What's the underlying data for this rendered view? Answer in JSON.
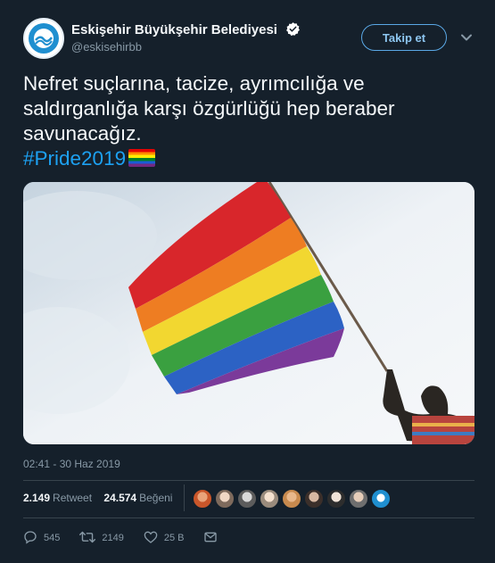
{
  "author": {
    "name": "Eskişehir Büyükşehir Belediyesi",
    "handle": "@eskisehirbb",
    "verified": true
  },
  "follow_button": "Takip et",
  "tweet": {
    "text_line1": "Nefret suçlarına, tacize, ayrımcılığa ve",
    "text_line2": "saldırganlığa karşı özgürlüğü hep beraber",
    "text_line3": "savunacağız.",
    "hashtag": "#Pride2019",
    "emoji": "rainbow-flag-emoji"
  },
  "timestamp": "02:41 - 30 Haz 2019",
  "stats": {
    "retweet_count": "2.149",
    "retweet_label": "Retweet",
    "like_count": "24.574",
    "like_label": "Beğeni"
  },
  "actions": {
    "reply_count": "545",
    "retweet_count": "2149",
    "like_count": "25 B"
  },
  "colors": {
    "background": "#15202b",
    "accent": "#1da1f2",
    "muted_text": "#8899a6"
  },
  "icons": [
    "verified-badge-icon",
    "chevron-down-icon",
    "reply-icon",
    "retweet-icon",
    "heart-icon",
    "message-icon"
  ]
}
